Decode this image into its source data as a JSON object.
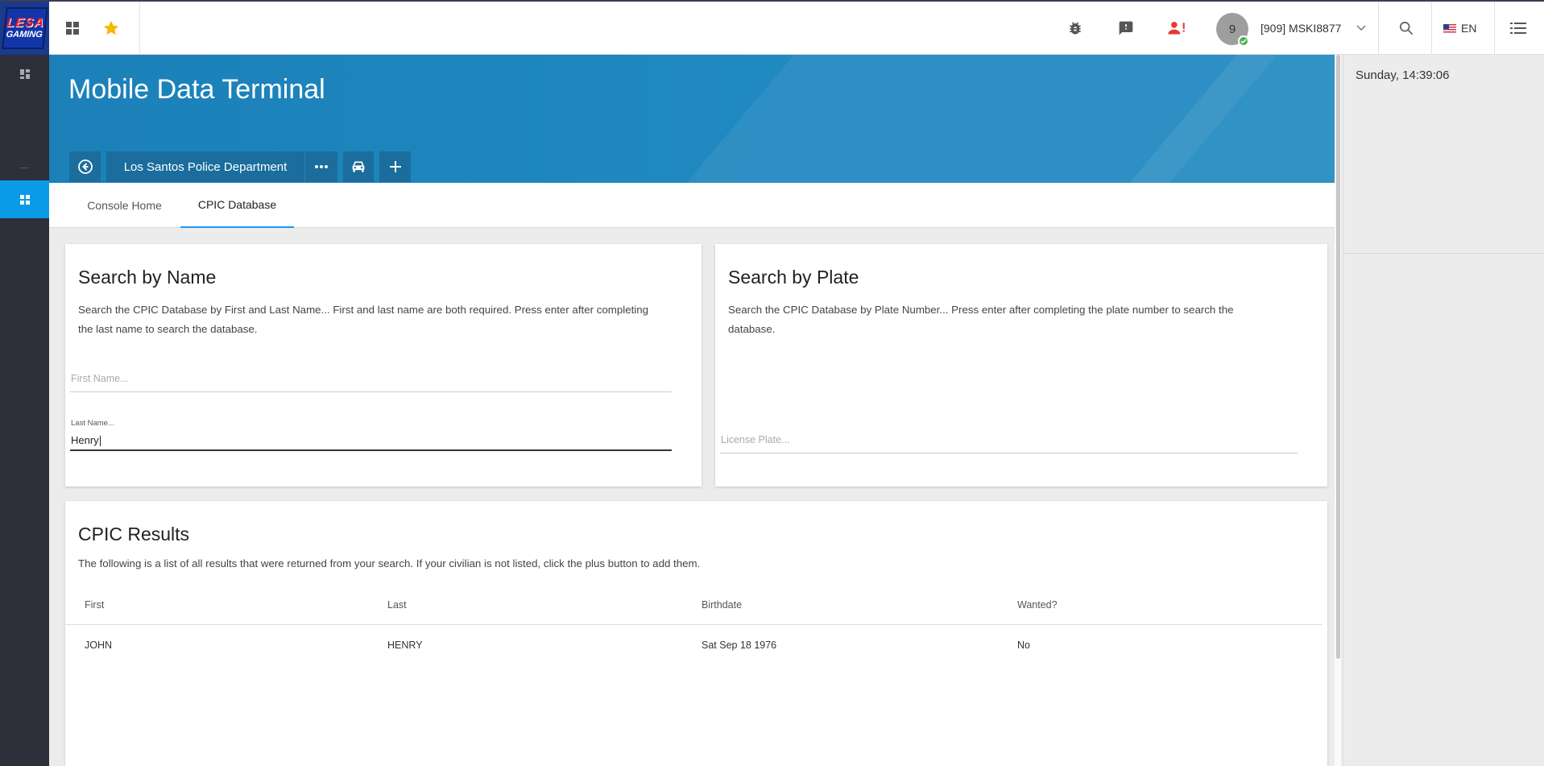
{
  "topbar": {
    "logo": {
      "line1": "LESA",
      "line2": "GAMING"
    },
    "user": {
      "avatar_initial": "9",
      "name": "[909] MSKI8877"
    },
    "language": "EN",
    "icons": [
      "apps-icon",
      "star-icon",
      "bug-icon",
      "feedback-icon",
      "person-alert-icon",
      "chevron-down-icon",
      "search-icon",
      "flag-us-icon",
      "list-icon"
    ],
    "colors": {
      "star": "#f5b800",
      "person_alert": "#e53935",
      "status_online": "#4caf50"
    }
  },
  "sidebar": {
    "items": [
      {
        "icon": "dashboard-icon",
        "active": false
      },
      {
        "icon": "grid-icon",
        "active": true
      }
    ],
    "accent": "#0a9be8"
  },
  "banner": {
    "title": "Mobile Data Terminal",
    "department": "Los Santos Police Department",
    "color": "#2089c0"
  },
  "tabs": [
    {
      "label": "Console Home",
      "active": false
    },
    {
      "label": "CPIC Database",
      "active": true
    }
  ],
  "right_panel": {
    "datetime": "Sunday, 14:39:06"
  },
  "search_name": {
    "title": "Search by Name",
    "description_line1": "Search the CPIC Database by First and Last Name... First and last name are both required. Press enter after completing",
    "description_line2": "the last name to search the database.",
    "first_name": {
      "placeholder": "First Name...",
      "value": ""
    },
    "last_name": {
      "label": "Last Name...",
      "value": "Henry"
    }
  },
  "search_plate": {
    "title": "Search by Plate",
    "description_line1": "Search the CPIC Database by Plate Number... Press enter after completing the plate number to search the",
    "description_line2": "database.",
    "plate": {
      "placeholder": "License Plate...",
      "value": ""
    }
  },
  "results": {
    "title": "CPIC Results",
    "description": "The following is a list of all results that were returned from your search. If your civilian is not listed, click the plus button to add them.",
    "columns": [
      "First",
      "Last",
      "Birthdate",
      "Wanted?"
    ],
    "rows": [
      [
        "JOHN",
        "HENRY",
        "Sat Sep 18 1976",
        "No"
      ]
    ]
  }
}
